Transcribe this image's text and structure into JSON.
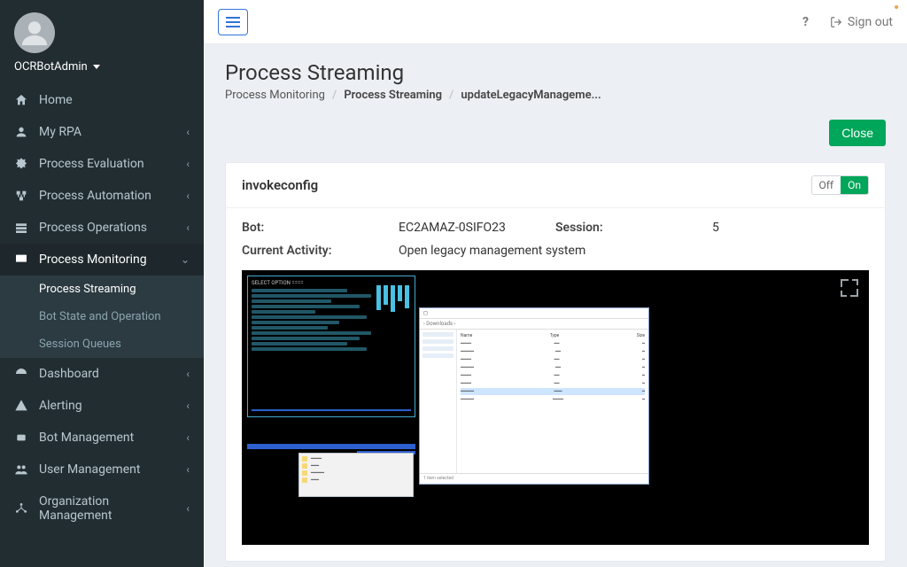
{
  "user": {
    "name": "OCRBotAdmin"
  },
  "topbar": {
    "help_tooltip": "?",
    "signout_label": "Sign out"
  },
  "page": {
    "title": "Process Streaming",
    "crumb1": "Process Monitoring",
    "crumb2": "Process Streaming",
    "crumb3": "updateLegacyManageme...",
    "close_label": "Close"
  },
  "sidebar": {
    "items": [
      {
        "label": "Home",
        "icon": "home"
      },
      {
        "label": "My RPA",
        "icon": "person",
        "chev": true
      },
      {
        "label": "Process Evaluation",
        "icon": "check-badge",
        "chev": true
      },
      {
        "label": "Process Automation",
        "icon": "automation",
        "chev": true
      },
      {
        "label": "Process Operations",
        "icon": "operations",
        "chev": true
      },
      {
        "label": "Process Monitoring",
        "icon": "monitor",
        "chev": true,
        "active": true
      },
      {
        "label": "Dashboard",
        "icon": "dashboard",
        "chev": true
      },
      {
        "label": "Alerting",
        "icon": "alert",
        "chev": true
      },
      {
        "label": "Bot Management",
        "icon": "bot",
        "chev": true
      },
      {
        "label": "User Management",
        "icon": "users",
        "chev": true
      },
      {
        "label": "Organization Management",
        "icon": "org",
        "chev": true
      }
    ],
    "sub_monitoring": [
      {
        "label": "Process Streaming",
        "active": true
      },
      {
        "label": "Bot State and Operation"
      },
      {
        "label": "Session Queues"
      }
    ]
  },
  "panel": {
    "title": "invokeconfig",
    "toggle_off": "Off",
    "toggle_on": "On",
    "bot_label": "Bot:",
    "bot_value": "EC2AMAZ-0SIFO23",
    "session_label": "Session:",
    "session_value": "5",
    "activity_label": "Current Activity:",
    "activity_value": "Open legacy management system"
  }
}
